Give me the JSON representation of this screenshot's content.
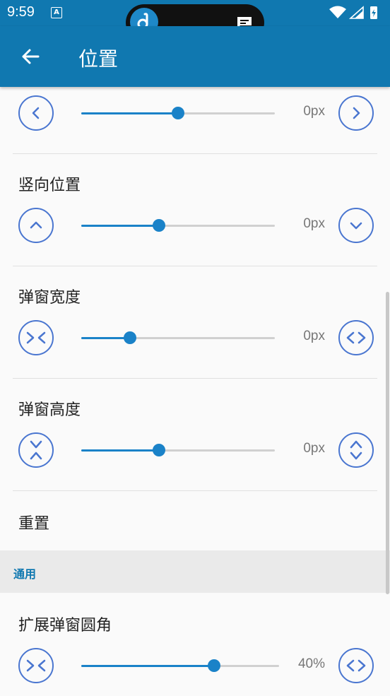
{
  "status_bar": {
    "time": "9:59",
    "notification_badge": "A"
  },
  "app_bar": {
    "title": "位置"
  },
  "colors": {
    "primary": "#1078b0",
    "accent": "#1a82c8",
    "button_stroke": "#4a76d0"
  },
  "rows": [
    {
      "id": "horizontal",
      "label": "",
      "value": "0px",
      "progress": 0.5,
      "left_icon": "chevron-left-icon",
      "right_icon": "chevron-right-icon"
    },
    {
      "id": "vertical",
      "label": "竖向位置",
      "value": "0px",
      "progress": 0.4,
      "left_icon": "chevron-up-icon",
      "right_icon": "chevron-down-icon"
    },
    {
      "id": "width",
      "label": "弹窗宽度",
      "value": "0px",
      "progress": 0.25,
      "left_icon": "shrink-horizontal-icon",
      "right_icon": "expand-horizontal-icon"
    },
    {
      "id": "height",
      "label": "弹窗高度",
      "value": "0px",
      "progress": 0.4,
      "left_icon": "shrink-vertical-icon",
      "right_icon": "expand-vertical-icon"
    }
  ],
  "reset_label": "重置",
  "section_general": "通用",
  "corner_row": {
    "label": "扩展弹窗圆角",
    "value": "40%",
    "progress": 0.67,
    "left_icon": "shrink-horizontal-icon",
    "right_icon": "expand-horizontal-icon"
  }
}
